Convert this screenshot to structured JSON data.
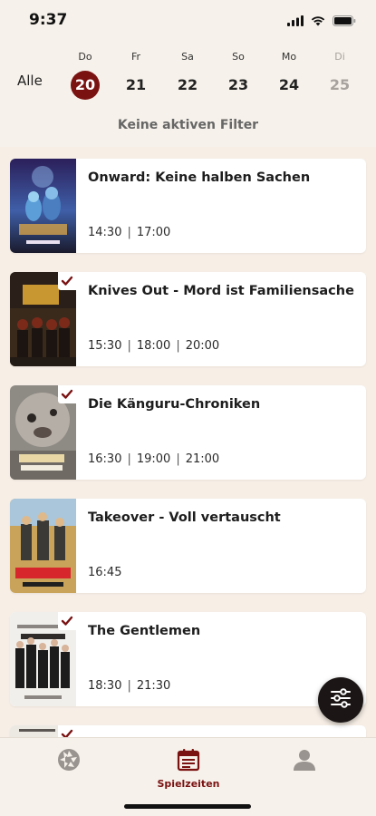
{
  "status_bar": {
    "time": "9:37"
  },
  "date_header": {
    "all_label": "Alle",
    "days": [
      {
        "abbr": "Do",
        "num": "20",
        "selected": true
      },
      {
        "abbr": "Fr",
        "num": "21"
      },
      {
        "abbr": "Sa",
        "num": "22"
      },
      {
        "abbr": "So",
        "num": "23"
      },
      {
        "abbr": "Mo",
        "num": "24"
      },
      {
        "abbr": "Di",
        "num": "25",
        "disabled": true
      }
    ],
    "filter_status": "Keine aktiven Filter"
  },
  "movies": [
    {
      "title": "Onward: Keine halben Sachen",
      "times": [
        "14:30",
        "17:00"
      ],
      "checked": false,
      "poster_icon": "onward-poster"
    },
    {
      "title": "Knives Out - Mord ist Familiensache",
      "times": [
        "15:30",
        "18:00",
        "20:00"
      ],
      "checked": true,
      "poster_icon": "knives-out-poster"
    },
    {
      "title": "Die Känguru-Chroniken",
      "times": [
        "16:30",
        "19:00",
        "21:00"
      ],
      "checked": true,
      "poster_icon": "kaenguru-chroniken-poster"
    },
    {
      "title": "Takeover - Voll vertauscht",
      "times": [
        "16:45"
      ],
      "checked": false,
      "poster_icon": "takeover-poster"
    },
    {
      "title": "The Gentlemen",
      "times": [
        "18:30",
        "21:30"
      ],
      "checked": true,
      "poster_icon": "the-gentlemen-poster"
    },
    {
      "title": "",
      "times": [],
      "checked": true,
      "poster_icon": "partial-poster"
    }
  ],
  "fab": {
    "icon": "filter-sliders-icon"
  },
  "tab_bar": {
    "tabs": [
      {
        "icon": "aperture-icon",
        "label": ""
      },
      {
        "icon": "calendar-icon",
        "label": "Spielzeiten",
        "active": true
      },
      {
        "icon": "user-icon",
        "label": ""
      }
    ]
  },
  "colors": {
    "accent": "#7a1212",
    "background": "#f7efe6",
    "card": "#ffffff",
    "fab": "#1b1615"
  }
}
